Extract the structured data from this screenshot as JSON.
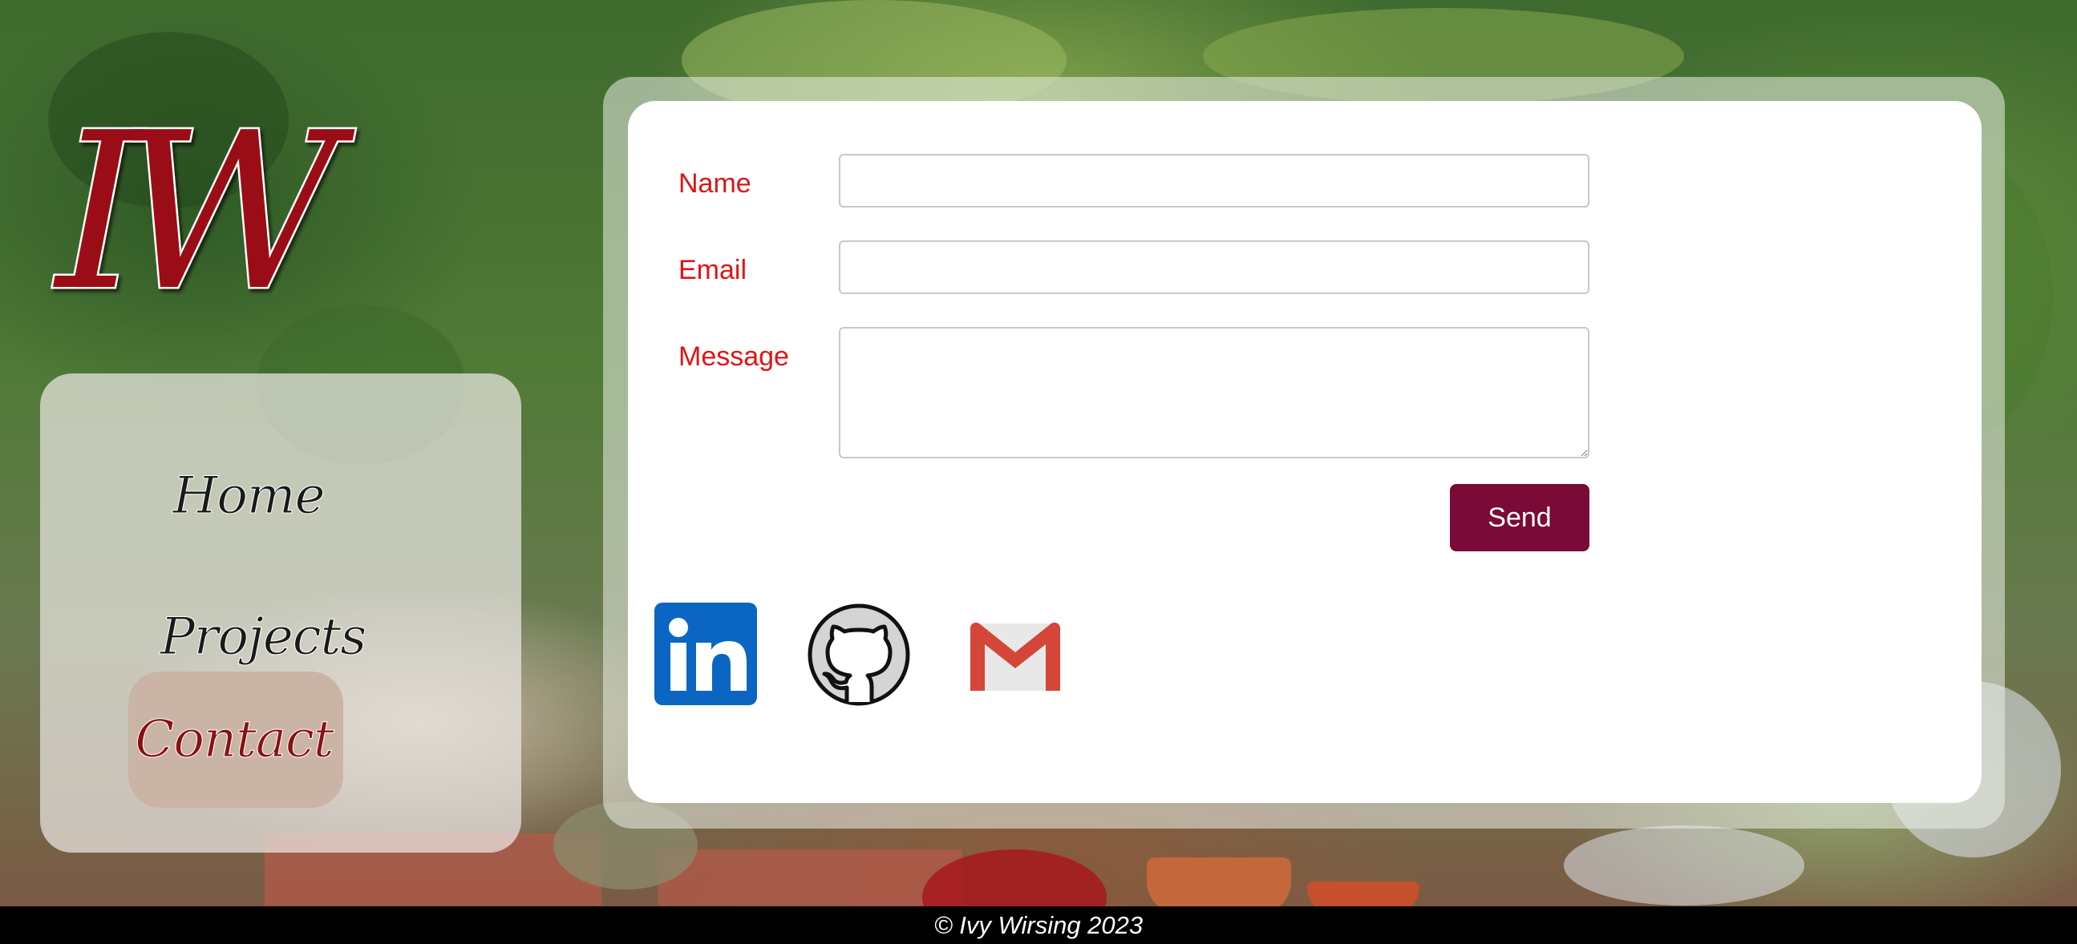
{
  "logo": {
    "monogram": "IW"
  },
  "nav": {
    "items": [
      {
        "label": "Home",
        "active": false
      },
      {
        "label": "Projects",
        "active": false
      },
      {
        "label": "Contact",
        "active": true
      }
    ]
  },
  "form": {
    "name_label": "Name",
    "name_value": "",
    "email_label": "Email",
    "email_value": "",
    "message_label": "Message",
    "message_value": "",
    "send_label": "Send"
  },
  "social": {
    "linkedin": {
      "icon": "linkedin-icon",
      "color": "#0a66c2"
    },
    "github": {
      "icon": "github-icon",
      "color": "#000000"
    },
    "gmail": {
      "icon": "gmail-icon",
      "color": "#d44638"
    }
  },
  "footer": {
    "copyright": "© Ivy Wirsing 2023"
  },
  "colors": {
    "label_red": "#e01414",
    "send_button": "#7a0a36",
    "active_nav_bg": "#c9b4a6",
    "active_nav_text": "#8b0f14",
    "logo_red": "#9b0e14"
  }
}
